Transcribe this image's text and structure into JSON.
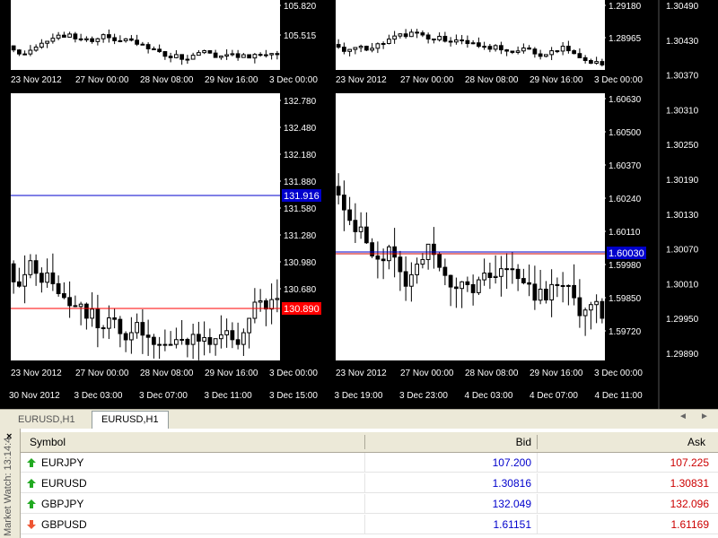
{
  "colors": {
    "chart_bg": "#ffffff",
    "frame_bg": "#000000",
    "price_line_blue": "#0000cc",
    "price_line_red": "#ff0000",
    "bid_blue": "#0000cc",
    "ask_red": "#cc0000",
    "up_arrow": "#22aa22",
    "down_arrow": "#ee5533"
  },
  "charts": [
    {
      "id": "top-left",
      "xlabels": [
        "23 Nov 2012",
        "27 Nov 00:00",
        "28 Nov 08:00",
        "29 Nov 16:00",
        "3 Dec 00:00"
      ],
      "ylabels": [
        "105.820",
        "105.515"
      ]
    },
    {
      "id": "top-right",
      "xlabels": [
        "23 Nov 2012",
        "27 Nov 00:00",
        "28 Nov 08:00",
        "29 Nov 16:00",
        "3 Dec 00:00"
      ],
      "ylabels": [
        "1.29180",
        "1.28965"
      ]
    },
    {
      "id": "gbpjpy",
      "xlabels": [
        "23 Nov 2012",
        "27 Nov 00:00",
        "28 Nov 08:00",
        "29 Nov 16:00",
        "3 Dec 00:00"
      ],
      "ylabels": [
        "132.780",
        "132.480",
        "132.180",
        "131.880",
        "131.580",
        "131.280",
        "130.980",
        "130.680"
      ],
      "bid_tag": "131.916",
      "low_tag": "130.890"
    },
    {
      "id": "gbpusd",
      "xlabels": [
        "23 Nov 2012",
        "27 Nov 00:00",
        "28 Nov 08:00",
        "29 Nov 16:00",
        "3 Dec 00:00"
      ],
      "ylabels": [
        "1.60630",
        "1.60500",
        "1.60370",
        "1.60240",
        "1.60110",
        "1.59980",
        "1.59850",
        "1.59720"
      ],
      "bid_tag": "1.60030"
    },
    {
      "id": "eurusd",
      "xlabels": [
        "30 Nov 2012",
        "3 Dec 03:00",
        "3 Dec 07:00",
        "3 Dec 11:00",
        "3 Dec 15:00",
        "3 Dec 19:00",
        "3 Dec 23:00",
        "4 Dec 03:00",
        "4 Dec 07:00",
        "4 Dec 11:00"
      ],
      "ylabels": [
        "1.30490",
        "1.30430",
        "1.30370",
        "1.30310",
        "1.30250",
        "1.30190",
        "1.30130",
        "1.30070",
        "1.30010",
        "1.29950",
        "1.29890"
      ]
    }
  ],
  "tabs": [
    {
      "label": "EURUSD,H1"
    },
    {
      "label": "EURUSD,H1"
    }
  ],
  "market_watch": {
    "title": "Market Watch: 13:14:4",
    "close": "×",
    "columns": {
      "symbol": "Symbol",
      "bid": "Bid",
      "ask": "Ask"
    },
    "rows": [
      {
        "symbol": "EURJPY",
        "bid": "107.200",
        "ask": "107.225",
        "dir": "up"
      },
      {
        "symbol": "EURUSD",
        "bid": "1.30816",
        "ask": "1.30831",
        "dir": "up"
      },
      {
        "symbol": "GBPJPY",
        "bid": "132.049",
        "ask": "132.096",
        "dir": "up"
      },
      {
        "symbol": "GBPUSD",
        "bid": "1.61151",
        "ask": "1.61169",
        "dir": "down"
      }
    ]
  }
}
